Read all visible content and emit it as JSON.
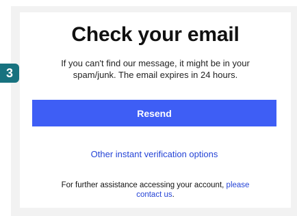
{
  "step": {
    "number": "3"
  },
  "heading": {
    "title": "Check your email"
  },
  "message": {
    "line1": "If you can't find our message, it might be in your",
    "line2": "spam/junk. The email expires in 24 hours."
  },
  "actions": {
    "resend_label": "Resend",
    "other_options_label": "Other instant verification options"
  },
  "assistance": {
    "text": "For further assistance accessing your account, ",
    "link_part1": "please",
    "link_part2": "contact us",
    "trailing": "."
  },
  "colors": {
    "accent_button": "#3e5ef5",
    "link": "#2443d6",
    "badge": "#17727f",
    "panel_bg": "#f2f2f2"
  }
}
